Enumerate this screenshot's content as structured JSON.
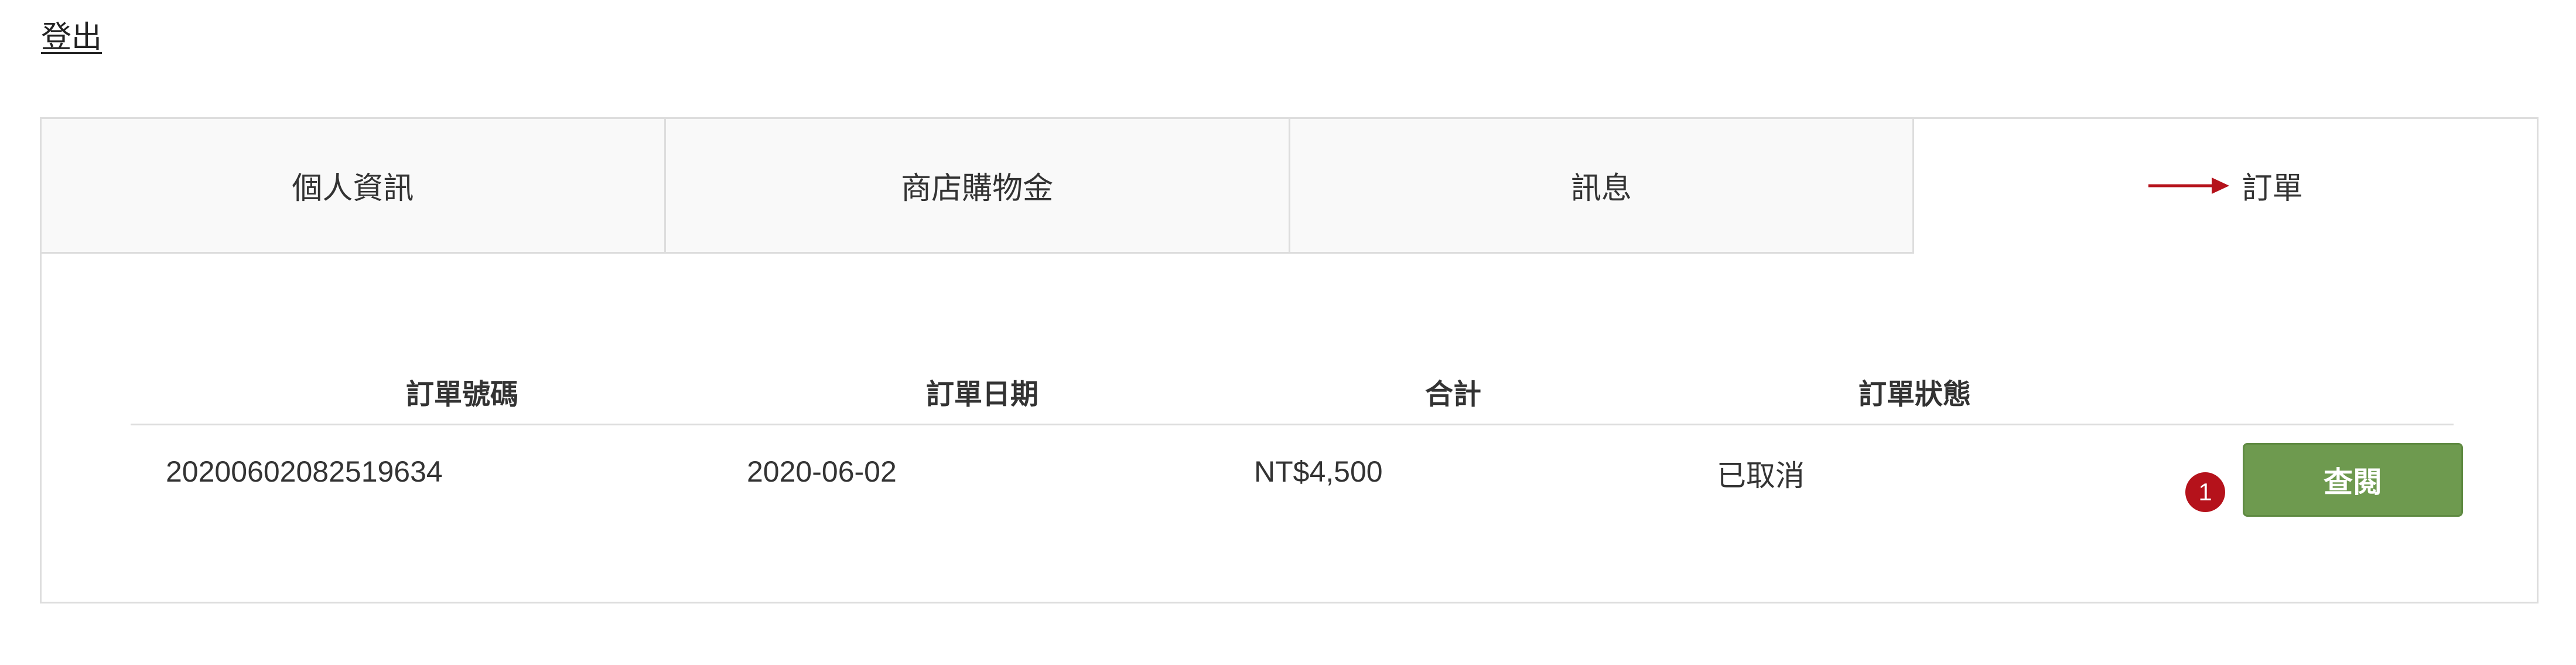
{
  "header": {
    "logout_label": "登出"
  },
  "tabs": [
    {
      "label": "個人資訊",
      "active": false
    },
    {
      "label": "商店購物金",
      "active": false
    },
    {
      "label": "訊息",
      "active": false
    },
    {
      "label": "訂單",
      "active": true
    }
  ],
  "annotation": {
    "arrow_color": "#b5121b",
    "step_number": "1"
  },
  "orders_table": {
    "columns": [
      "訂單號碼",
      "訂單日期",
      "合計",
      "訂單狀態",
      ""
    ],
    "rows": [
      {
        "order_number": "20200602082519634",
        "order_date": "2020-06-02",
        "total": "NT$4,500",
        "status": "已取消",
        "action_label": "查閱"
      }
    ]
  },
  "colors": {
    "button_green": "#6e9a4f",
    "badge_red": "#b5121b",
    "border_gray": "#dddddd",
    "tab_bg": "#f9f9f9"
  }
}
